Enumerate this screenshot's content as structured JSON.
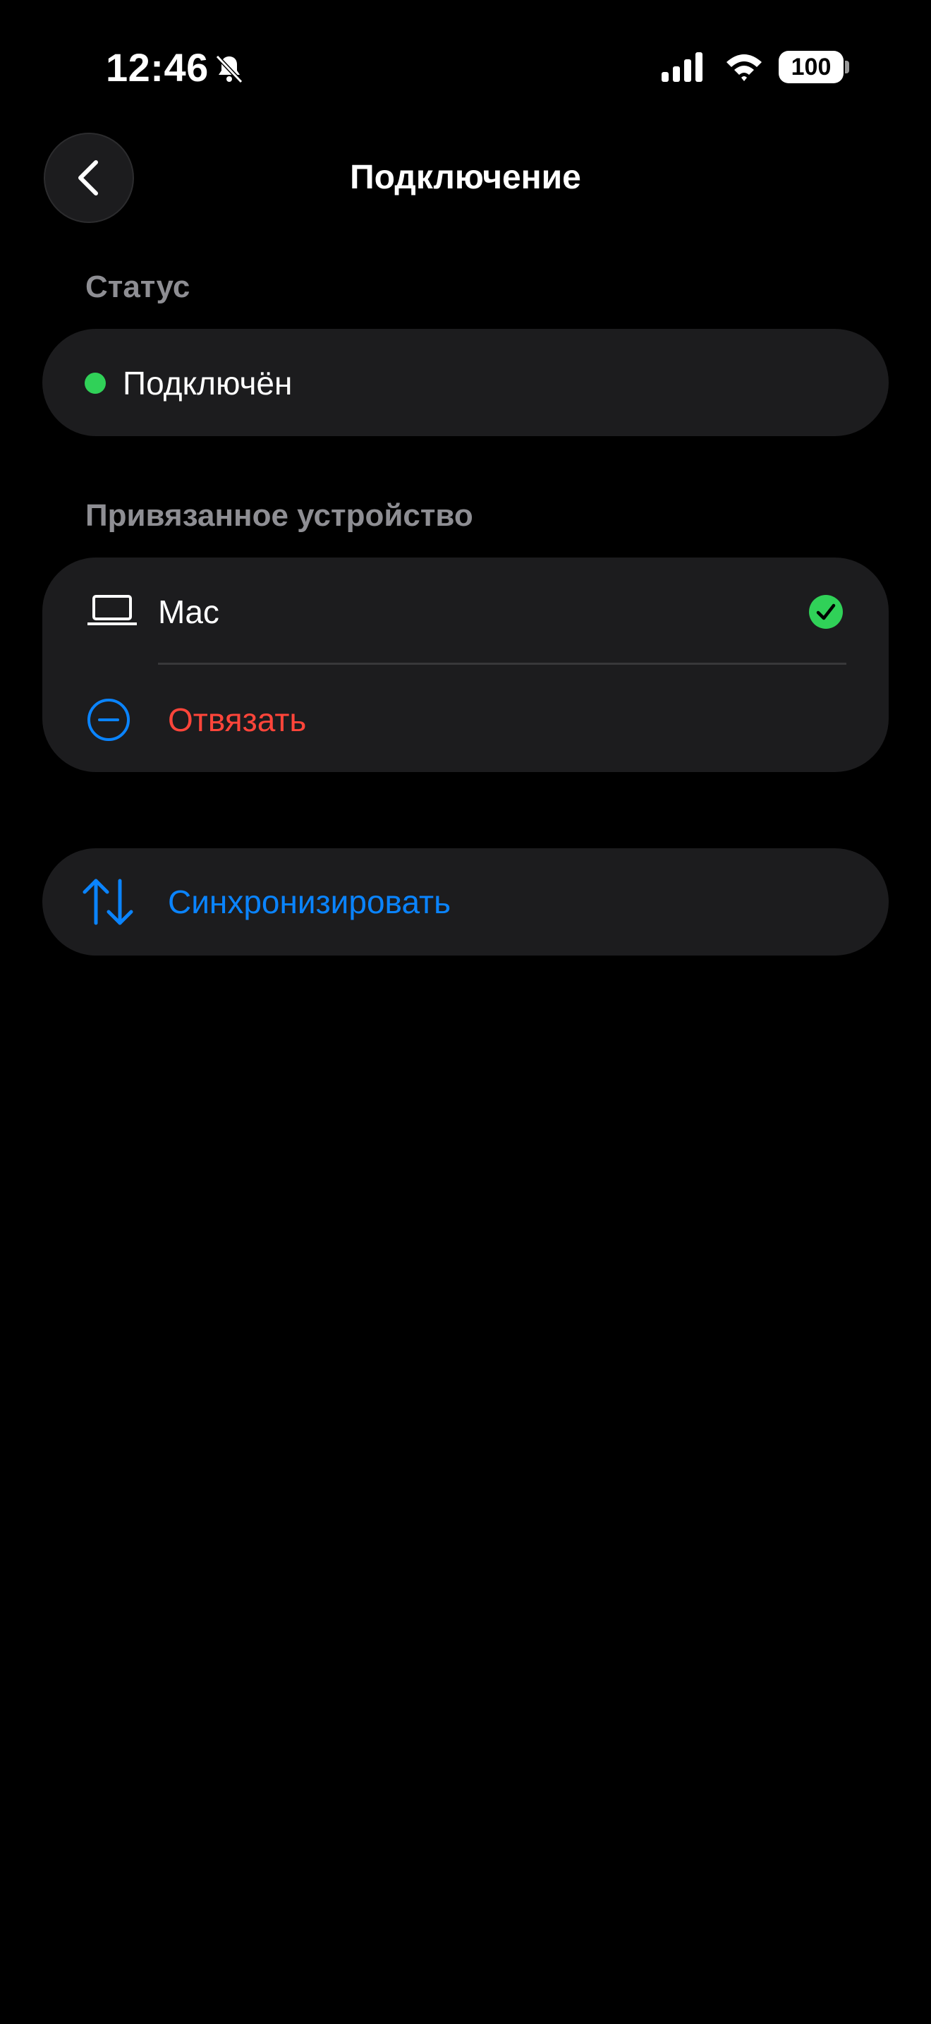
{
  "status_bar": {
    "time": "12:46",
    "battery": "100",
    "icons": [
      "bell-slash-icon",
      "cellular-signal-icon",
      "wifi-icon",
      "battery-icon"
    ]
  },
  "nav": {
    "title": "Подключение",
    "back_icon": "chevron-left-icon"
  },
  "status_section": {
    "header": "Статус",
    "value": "Подключён",
    "indicator_color": "#30d158"
  },
  "device_section": {
    "header": "Привязанное устройство",
    "device_name": "Mac",
    "device_icon": "laptop-icon",
    "selected_icon": "checkmark-circle-icon",
    "unlink_label": "Отвязать",
    "unlink_icon": "minus-circle-icon",
    "unlink_color": "#ff453a"
  },
  "sync": {
    "label": "Синхронизировать",
    "icon": "arrows-up-down-icon",
    "color": "#0a84ff"
  }
}
